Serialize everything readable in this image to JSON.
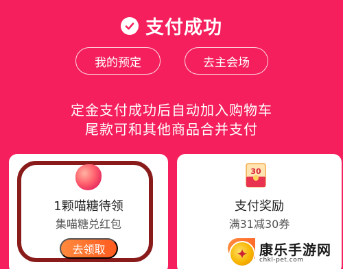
{
  "header": {
    "title": "支付成功"
  },
  "actions": {
    "my_reservation": "我的预定",
    "main_venue": "去主会场"
  },
  "message": {
    "line1": "定金支付成功后自动加入购物车",
    "line2": "尾款可和其他商品合并支付"
  },
  "cards": {
    "candy": {
      "title": "1颗喵糖待领",
      "subtitle": "集喵糖兑红包",
      "button": "去领取"
    },
    "reward": {
      "badge": "30",
      "title": "支付奖励",
      "subtitle": "满31减30券"
    }
  },
  "watermark": {
    "name": "康乐手游网",
    "url": "chkl-pet.com"
  },
  "colors": {
    "background": "#f41f5c",
    "button_orange": "#ff6a2a",
    "highlight_ring": "#8a1b1b"
  }
}
